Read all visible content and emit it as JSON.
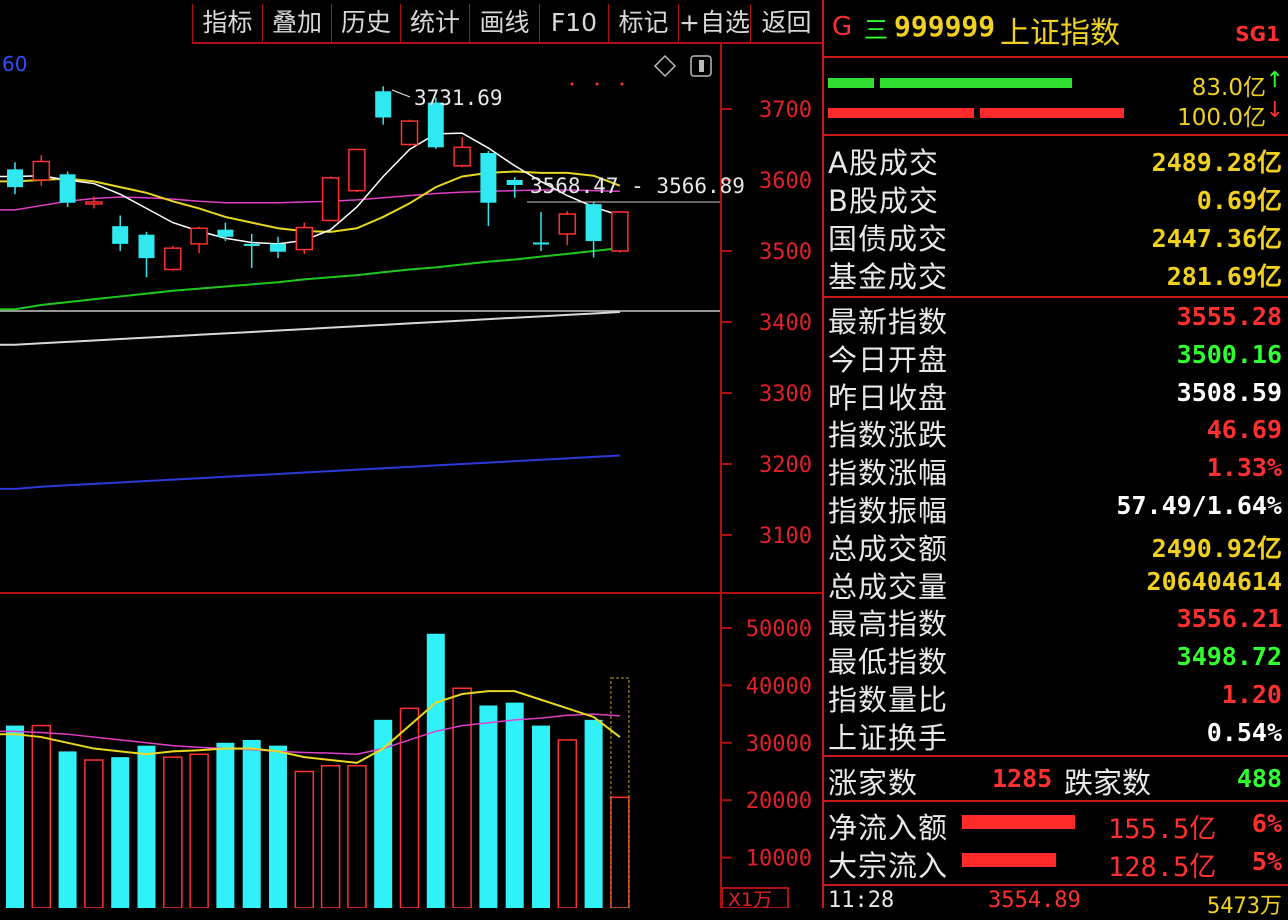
{
  "toolbar": {
    "buttons": [
      "指标",
      "叠加",
      "历史",
      "统计",
      "画线",
      "F10",
      "标记",
      "+自选",
      "返回"
    ]
  },
  "header": {
    "g_label": "G",
    "menu_glyph": "三",
    "code": "999999",
    "name": "上证指数",
    "sg": "SG1"
  },
  "flow_bars": {
    "buy_value": "83.0亿",
    "buy_arrow": "↑",
    "sell_value": "100.0亿",
    "sell_arrow": "↓"
  },
  "turnover": [
    {
      "label": "A股成交",
      "value": "2489.28亿",
      "color": "#f0d020"
    },
    {
      "label": "B股成交",
      "value": "0.69亿",
      "color": "#f0d020"
    },
    {
      "label": "国债成交",
      "value": "2447.36亿",
      "color": "#f0d020"
    },
    {
      "label": "基金成交",
      "value": "281.69亿",
      "color": "#f0d020"
    }
  ],
  "quote": [
    {
      "label": "最新指数",
      "value": "3555.28",
      "color": "#ff3030"
    },
    {
      "label": "今日开盘",
      "value": "3500.16",
      "color": "#30ff30"
    },
    {
      "label": "昨日收盘",
      "value": "3508.59",
      "color": "#ffffff"
    },
    {
      "label": "指数涨跌",
      "value": "46.69",
      "color": "#ff3030"
    },
    {
      "label": "指数涨幅",
      "value": "1.33%",
      "color": "#ff3030"
    },
    {
      "label": "指数振幅",
      "value": "57.49/1.64%",
      "color": "#ffffff"
    },
    {
      "label": "总成交额",
      "value": "2490.92亿",
      "color": "#f0d020"
    },
    {
      "label": "总成交量",
      "value": "206404614",
      "color": "#f0d020"
    },
    {
      "label": "最高指数",
      "value": "3556.21",
      "color": "#ff3030"
    },
    {
      "label": "最低指数",
      "value": "3498.72",
      "color": "#30ff30"
    },
    {
      "label": "指数量比",
      "value": "1.20",
      "color": "#ff3030"
    },
    {
      "label": "上证换手",
      "value": "0.54%",
      "color": "#ffffff"
    }
  ],
  "breadth": {
    "up_label": "涨家数",
    "up_value": "1285",
    "down_label": "跌家数",
    "down_value": "488"
  },
  "capital_flow": [
    {
      "label": "净流入额",
      "value": "155.5亿",
      "pct": "6%",
      "bar_ratio": 0.94
    },
    {
      "label": "大宗流入",
      "value": "128.5亿",
      "pct": "5%",
      "bar_ratio": 0.78
    }
  ],
  "tick": {
    "time": "11:28",
    "price": "3554.89",
    "volume": "5473万"
  },
  "chart_data": {
    "type": "candlestick",
    "partial_label": "60",
    "price_axis": {
      "ticks": [
        3700,
        3600,
        3500,
        3400,
        3300,
        3200,
        3100
      ],
      "range": [
        3050,
        3800
      ]
    },
    "volume_axis": {
      "ticks": [
        50000,
        40000,
        30000,
        20000,
        10000
      ],
      "range": [
        0,
        55000
      ],
      "unit": "X1万"
    },
    "annotations": {
      "high_label": "3731.69",
      "current_label": "3568.47 - 3566.89"
    },
    "candles": [
      {
        "o": 3590,
        "c": 3615,
        "h": 3625,
        "l": 3580,
        "up": false
      },
      {
        "o": 3600,
        "c": 3626,
        "h": 3635,
        "l": 3592,
        "up": true
      },
      {
        "o": 3608,
        "c": 3568,
        "h": 3612,
        "l": 3562,
        "up": false
      },
      {
        "o": 3569,
        "c": 3567,
        "h": 3577,
        "l": 3560,
        "up": true
      },
      {
        "o": 3535,
        "c": 3510,
        "h": 3550,
        "l": 3500,
        "up": false
      },
      {
        "o": 3523,
        "c": 3490,
        "h": 3527,
        "l": 3463,
        "up": false
      },
      {
        "o": 3474,
        "c": 3504,
        "h": 3507,
        "l": 3472,
        "up": true
      },
      {
        "o": 3510,
        "c": 3532,
        "h": 3534,
        "l": 3497,
        "up": true
      },
      {
        "o": 3530,
        "c": 3520,
        "h": 3540,
        "l": 3514,
        "up": false
      },
      {
        "o": 3510,
        "c": 3510,
        "h": 3524,
        "l": 3476,
        "up": false
      },
      {
        "o": 3510,
        "c": 3499,
        "h": 3520,
        "l": 3490,
        "up": false
      },
      {
        "o": 3502,
        "c": 3533,
        "h": 3540,
        "l": 3496,
        "up": true
      },
      {
        "o": 3543,
        "c": 3603,
        "h": 3605,
        "l": 3542,
        "up": true
      },
      {
        "o": 3585,
        "c": 3643,
        "h": 3644,
        "l": 3583,
        "up": true
      },
      {
        "o": 3688,
        "c": 3725,
        "h": 3732,
        "l": 3678,
        "up": false
      },
      {
        "o": 3650,
        "c": 3683,
        "h": 3685,
        "l": 3648,
        "up": true
      },
      {
        "o": 3709,
        "c": 3646,
        "h": 3716,
        "l": 3644,
        "up": false
      },
      {
        "o": 3620,
        "c": 3646,
        "h": 3660,
        "l": 3618,
        "up": true
      },
      {
        "o": 3638,
        "c": 3568,
        "h": 3641,
        "l": 3535,
        "up": false
      },
      {
        "o": 3593,
        "c": 3600,
        "h": 3604,
        "l": 3575,
        "up": false
      },
      {
        "o": 3512,
        "c": 3512,
        "h": 3555,
        "l": 3500,
        "up": false
      },
      {
        "o": 3524,
        "c": 3552,
        "h": 3556,
        "l": 3508,
        "up": true
      },
      {
        "o": 3566,
        "c": 3514,
        "h": 3570,
        "l": 3491,
        "up": false
      },
      {
        "o": 3500,
        "c": 3555,
        "h": 3556,
        "l": 3498,
        "up": true
      }
    ],
    "volumes": [
      {
        "v": 33000,
        "up": false
      },
      {
        "v": 33000,
        "up": true
      },
      {
        "v": 28500,
        "up": false
      },
      {
        "v": 27000,
        "up": true
      },
      {
        "v": 27500,
        "up": false
      },
      {
        "v": 29500,
        "up": false
      },
      {
        "v": 27500,
        "up": true
      },
      {
        "v": 28000,
        "up": true
      },
      {
        "v": 30000,
        "up": false
      },
      {
        "v": 30500,
        "up": false
      },
      {
        "v": 29500,
        "up": false
      },
      {
        "v": 25000,
        "up": true
      },
      {
        "v": 26000,
        "up": true
      },
      {
        "v": 26000,
        "up": true
      },
      {
        "v": 34000,
        "up": false
      },
      {
        "v": 36000,
        "up": true
      },
      {
        "v": 49000,
        "up": false
      },
      {
        "v": 39500,
        "up": true
      },
      {
        "v": 36500,
        "up": false
      },
      {
        "v": 37000,
        "up": false
      },
      {
        "v": 33000,
        "up": false
      },
      {
        "v": 30500,
        "up": true
      },
      {
        "v": 34000,
        "up": false
      },
      {
        "v": 20500,
        "up": true
      }
    ],
    "ma5": [
      3605,
      3606,
      3600,
      3595,
      3580,
      3560,
      3540,
      3528,
      3518,
      3512,
      3510,
      3515,
      3530,
      3562,
      3605,
      3643,
      3665,
      3666,
      3645,
      3620,
      3598,
      3578,
      3562,
      3550
    ],
    "ma10": [
      3598,
      3600,
      3602,
      3598,
      3590,
      3582,
      3570,
      3560,
      3548,
      3540,
      3532,
      3528,
      3527,
      3532,
      3548,
      3567,
      3590,
      3605,
      3610,
      3612,
      3610,
      3610,
      3606,
      3592
    ],
    "ma20": [
      3558,
      3564,
      3570,
      3574,
      3576,
      3575,
      3573,
      3570,
      3568,
      3568,
      3568,
      3569,
      3570,
      3572,
      3575,
      3578,
      3581,
      3583,
      3584,
      3585,
      3586,
      3586,
      3585,
      3584
    ],
    "ma60": [
      3418,
      3424,
      3428,
      3432,
      3436,
      3440,
      3444,
      3447,
      3450,
      3453,
      3456,
      3460,
      3463,
      3466,
      3470,
      3474,
      3477,
      3481,
      3485,
      3488,
      3492,
      3496,
      3500,
      3504
    ],
    "ma120": [
      3368,
      3370,
      3372,
      3374,
      3376,
      3378,
      3380,
      3382,
      3384,
      3386,
      3388,
      3390,
      3392,
      3394,
      3396,
      3398,
      3400,
      3402,
      3404,
      3406,
      3408,
      3410,
      3412,
      3414
    ],
    "ma250": [
      3165,
      3168,
      3170,
      3172,
      3174,
      3176,
      3178,
      3180,
      3182,
      3184,
      3186,
      3188,
      3190,
      3192,
      3194,
      3196,
      3198,
      3200,
      3202,
      3204,
      3206,
      3208,
      3210,
      3212
    ],
    "vol_ma5": [
      31500,
      31000,
      30000,
      29000,
      28500,
      28000,
      28500,
      28700,
      29000,
      29000,
      28500,
      27500,
      27000,
      26500,
      29000,
      33000,
      37000,
      38500,
      39000,
      39000,
      37500,
      36000,
      34500,
      31000
    ],
    "vol_ma10": [
      32000,
      31800,
      31500,
      31000,
      30500,
      30000,
      29500,
      29200,
      29000,
      28800,
      28500,
      28300,
      28200,
      28000,
      29000,
      30500,
      32000,
      33000,
      33500,
      34000,
      34300,
      34800,
      35000,
      34700
    ]
  }
}
